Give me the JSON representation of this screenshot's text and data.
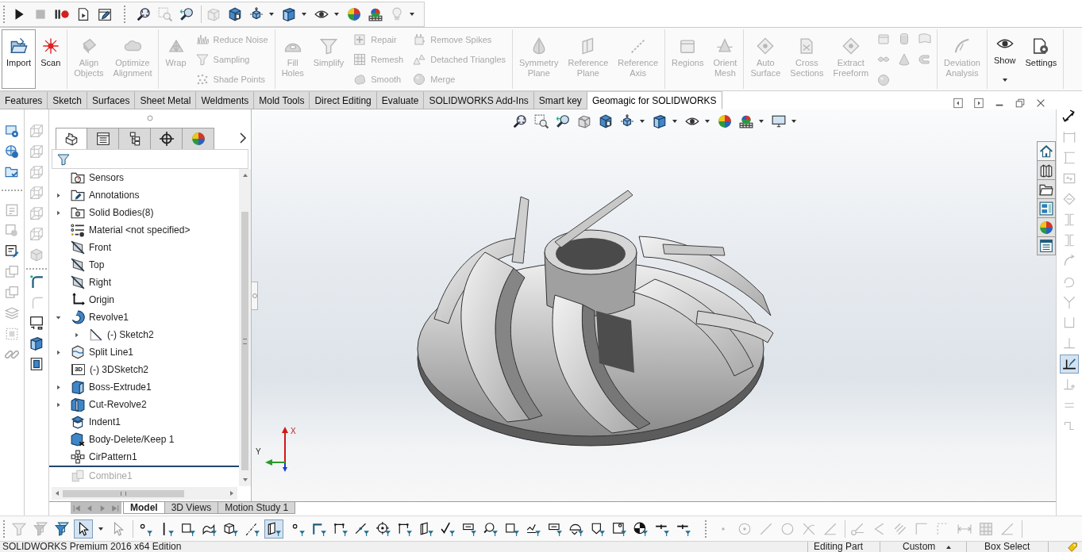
{
  "quick_toolbar": {
    "groups": [
      [
        {
          "disabled": false
        },
        {
          "disabled": true
        },
        {
          "disabled": false
        },
        {
          "disabled": false
        },
        {
          "disabled": false
        }
      ],
      [
        {
          "disabled": false
        },
        {
          "disabled": true
        },
        {
          "disabled": false
        }
      ],
      [
        {
          "disabled": true
        },
        {
          "disabled": false
        },
        {
          "disabled": false,
          "dropdown": true
        },
        {
          "disabled": false,
          "dropdown": true
        },
        {
          "disabled": false,
          "dropdown": true
        },
        {
          "disabled": false
        },
        {
          "disabled": false
        },
        {
          "disabled": true,
          "dropdown": true
        }
      ]
    ]
  },
  "ribbon": {
    "groups": [
      {
        "columns": [
          {
            "kind": "large",
            "label": "Import",
            "disabled": false,
            "highlighted": true
          },
          {
            "kind": "large",
            "label": "Scan",
            "disabled": false,
            "highlighted": false
          }
        ]
      },
      {
        "columns": [
          {
            "kind": "large",
            "label": "Align Objects",
            "disabled": true,
            "highlighted": false
          },
          {
            "kind": "large",
            "label": "Optimize Alignment",
            "disabled": true,
            "highlighted": false
          }
        ]
      },
      {
        "columns": [
          {
            "kind": "large",
            "label": "Wrap",
            "disabled": true,
            "highlighted": false
          },
          {
            "kind": "stack",
            "items": [
              {
                "label": "Reduce Noise",
                "disabled": true
              },
              {
                "label": "Sampling",
                "disabled": true
              },
              {
                "label": "Shade Points",
                "disabled": true
              }
            ]
          }
        ]
      },
      {
        "columns": [
          {
            "kind": "large",
            "label": "Fill Holes",
            "disabled": true,
            "highlighted": false
          },
          {
            "kind": "large",
            "label": "Simplify",
            "disabled": true,
            "highlighted": false
          },
          {
            "kind": "stack",
            "items": [
              {
                "label": "Repair",
                "disabled": true
              },
              {
                "label": "Remesh",
                "disabled": true
              },
              {
                "label": "Smooth",
                "disabled": true
              }
            ]
          },
          {
            "kind": "stack",
            "items": [
              {
                "label": "Remove Spikes",
                "disabled": true
              },
              {
                "label": "Detached Triangles",
                "disabled": true
              },
              {
                "label": "Merge",
                "disabled": true
              }
            ]
          }
        ]
      },
      {
        "columns": [
          {
            "kind": "large",
            "label": "Symmetry Plane",
            "disabled": true,
            "highlighted": false
          },
          {
            "kind": "large",
            "label": "Reference Plane",
            "disabled": true,
            "highlighted": false
          },
          {
            "kind": "large",
            "label": "Reference Axis",
            "disabled": true,
            "highlighted": false
          }
        ]
      },
      {
        "columns": [
          {
            "kind": "large",
            "label": "Regions",
            "disabled": true,
            "highlighted": false
          },
          {
            "kind": "large",
            "label": "Orient Mesh",
            "disabled": true,
            "highlighted": false
          }
        ]
      },
      {
        "columns": [
          {
            "kind": "large",
            "label": "Auto Surface",
            "disabled": true,
            "highlighted": false
          },
          {
            "kind": "large",
            "label": "Cross Sections",
            "disabled": true,
            "highlighted": false
          },
          {
            "kind": "large",
            "label": "Extract Freeform",
            "disabled": true,
            "highlighted": false
          },
          {
            "kind": "grid",
            "items": [
              {
                "disabled": true
              },
              {
                "disabled": true
              },
              {
                "disabled": true
              },
              {
                "disabled": true
              },
              {
                "disabled": true
              },
              {
                "disabled": true
              },
              {
                "disabled": true
              }
            ]
          }
        ]
      },
      {
        "columns": [
          {
            "kind": "large",
            "label": "Deviation Analysis",
            "disabled": true,
            "highlighted": false
          }
        ]
      },
      {
        "columns": [
          {
            "kind": "large",
            "label": "Show",
            "disabled": false,
            "highlighted": false,
            "dropdown": true
          },
          {
            "kind": "large",
            "label": "Settings",
            "disabled": false,
            "highlighted": false
          }
        ]
      }
    ]
  },
  "command_tabs": [
    {
      "label": "Features",
      "selected": false
    },
    {
      "label": "Sketch",
      "selected": false
    },
    {
      "label": "Surfaces",
      "selected": false
    },
    {
      "label": "Sheet Metal",
      "selected": false
    },
    {
      "label": "Weldments",
      "selected": false
    },
    {
      "label": "Mold Tools",
      "selected": false
    },
    {
      "label": "Direct Editing",
      "selected": false
    },
    {
      "label": "Evaluate",
      "selected": false
    },
    {
      "label": "SOLIDWORKS Add-Ins",
      "selected": false
    },
    {
      "label": "Smart key",
      "selected": false
    },
    {
      "label": "Geomagic for SOLIDWORKS",
      "selected": true
    }
  ],
  "left_toolbar": {
    "groups": [
      [
        {
          "disabled": false
        },
        {
          "disabled": false
        },
        {
          "disabled": false
        }
      ],
      [
        {
          "disabled": true
        },
        {
          "disabled": true
        },
        {
          "disabled": false
        },
        {
          "disabled": true
        },
        {
          "disabled": true
        },
        {
          "disabled": true
        },
        {
          "disabled": true
        },
        {
          "disabled": true
        }
      ]
    ]
  },
  "view_toolbar": {
    "groups": [
      [
        {
          "disabled": true
        },
        {
          "disabled": true
        },
        {
          "disabled": true
        },
        {
          "disabled": true
        },
        {
          "disabled": true
        },
        {
          "disabled": true
        },
        {
          "disabled": true
        }
      ],
      [
        {
          "disabled": false
        },
        {
          "disabled": true
        },
        {
          "disabled": false
        },
        {
          "disabled": false
        },
        {
          "disabled": false
        }
      ]
    ]
  },
  "feature_manager": {
    "tabs": [
      {
        "selected": true
      },
      {
        "selected": false
      },
      {
        "selected": false
      },
      {
        "selected": false
      },
      {
        "selected": false
      }
    ],
    "tree": [
      {
        "label": "Sensors",
        "kind": "sensors",
        "rolled_back": false
      },
      {
        "label": "Annotations",
        "kind": "annotations",
        "expanded": false,
        "rolled_back": false
      },
      {
        "label": "Solid Bodies(8)",
        "kind": "bodies",
        "expanded": false,
        "rolled_back": false
      },
      {
        "label": "Material <not specified>",
        "kind": "material",
        "rolled_back": false
      },
      {
        "label": "Front",
        "kind": "plane",
        "rolled_back": false
      },
      {
        "label": "Top",
        "kind": "plane",
        "rolled_back": false
      },
      {
        "label": "Right",
        "kind": "plane",
        "rolled_back": false
      },
      {
        "label": "Origin",
        "kind": "origin",
        "rolled_back": false
      },
      {
        "label": "Revolve1",
        "kind": "revolve",
        "expanded": true,
        "rolled_back": false,
        "children": [
          {
            "label": "(-) Sketch2",
            "kind": "sketch",
            "expanded": false,
            "rolled_back": false
          }
        ]
      },
      {
        "label": "Split Line1",
        "kind": "splitline",
        "expanded": false,
        "rolled_back": false
      },
      {
        "label": "(-) 3DSketch2",
        "kind": "sketch3d",
        "badge": "3D",
        "rolled_back": false
      },
      {
        "label": "Boss-Extrude1",
        "kind": "extrude",
        "expanded": false,
        "rolled_back": false
      },
      {
        "label": "Cut-Revolve2",
        "kind": "cut",
        "expanded": false,
        "rolled_back": false
      },
      {
        "label": "Indent1",
        "kind": "indent",
        "rolled_back": false
      },
      {
        "label": "Body-Delete/Keep 1",
        "kind": "delete",
        "rolled_back": false
      },
      {
        "label": "CirPattern1",
        "kind": "pattern",
        "rolled_back": false
      },
      {
        "label": "Combine1",
        "kind": "combine",
        "rolled_back": true
      }
    ]
  },
  "viewport": {
    "heads_up_toolbar": [
      {
        "kind": "button"
      },
      {
        "kind": "button"
      },
      {
        "kind": "button"
      },
      {
        "kind": "button"
      },
      {
        "kind": "button"
      },
      {
        "kind": "dropdown"
      },
      {
        "kind": "dropdown"
      },
      {
        "kind": "dropdown"
      },
      {
        "kind": "button"
      },
      {
        "kind": "dropdown"
      },
      {
        "kind": "dropdown"
      }
    ],
    "triad": {
      "x_label": "X",
      "y_label": "Y"
    }
  },
  "sketch_toolbar": [
    {
      "disabled": false,
      "selected": false
    },
    {
      "disabled": true,
      "selected": false
    },
    {
      "disabled": true,
      "selected": false
    },
    {
      "disabled": true,
      "selected": false
    },
    {
      "disabled": true,
      "selected": false
    },
    {
      "disabled": true,
      "selected": false
    },
    {
      "disabled": true,
      "selected": false
    },
    {
      "disabled": true,
      "selected": false
    },
    {
      "disabled": true,
      "selected": false
    },
    {
      "disabled": true,
      "selected": false
    },
    {
      "disabled": true,
      "selected": false
    },
    {
      "disabled": true,
      "selected": false
    },
    {
      "disabled": false,
      "selected": true
    },
    {
      "disabled": true,
      "selected": false
    },
    {
      "disabled": true,
      "selected": false
    },
    {
      "disabled": true,
      "selected": false
    }
  ],
  "bottom_tabs": {
    "navigation": [
      {
        "disabled": true
      },
      {
        "disabled": true
      },
      {
        "disabled": true
      },
      {
        "disabled": true
      }
    ],
    "tabs": [
      {
        "label": "Model",
        "selected": true
      },
      {
        "label": "3D Views",
        "selected": false
      },
      {
        "label": "Motion Study 1",
        "selected": false
      }
    ]
  },
  "selection_toolbar": {
    "groups": [
      [
        {
          "disabled": true,
          "selected": false
        },
        {
          "disabled": true,
          "selected": false
        },
        {
          "disabled": false,
          "selected": false
        },
        {
          "disabled": false,
          "selected": true,
          "dropdown": true
        },
        {
          "disabled": true,
          "selected": false
        }
      ],
      [
        {
          "disabled": false,
          "selected": false
        },
        {
          "disabled": false,
          "selected": false
        },
        {
          "disabled": false,
          "selected": false
        },
        {
          "disabled": false,
          "selected": false
        },
        {
          "disabled": false,
          "selected": false
        },
        {
          "disabled": false,
          "selected": false
        },
        {
          "disabled": false,
          "selected": true
        },
        {
          "disabled": false,
          "selected": false
        },
        {
          "disabled": false,
          "selected": false
        },
        {
          "disabled": false,
          "selected": false
        },
        {
          "disabled": false,
          "selected": false
        },
        {
          "disabled": false,
          "selected": false
        },
        {
          "disabled": false,
          "selected": false
        },
        {
          "disabled": false,
          "selected": false
        },
        {
          "disabled": false,
          "selected": false
        },
        {
          "disabled": false,
          "selected": false
        },
        {
          "disabled": false,
          "selected": false
        },
        {
          "disabled": false,
          "selected": false
        },
        {
          "disabled": false,
          "selected": false
        },
        {
          "disabled": false,
          "selected": false
        },
        {
          "disabled": false,
          "selected": false
        },
        {
          "disabled": false,
          "selected": false
        },
        {
          "disabled": false,
          "selected": false
        },
        {
          "disabled": false,
          "selected": false
        },
        {
          "disabled": false,
          "selected": false
        },
        {
          "disabled": false,
          "selected": false
        }
      ],
      [
        {
          "disabled": true,
          "selected": false
        },
        {
          "disabled": true,
          "selected": false
        },
        {
          "disabled": true,
          "selected": false
        },
        {
          "disabled": true,
          "selected": false
        },
        {
          "disabled": true,
          "selected": false
        },
        {
          "disabled": true,
          "selected": false
        }
      ],
      [
        {
          "disabled": true,
          "selected": false
        },
        {
          "disabled": true,
          "selected": false
        },
        {
          "disabled": true,
          "selected": false
        },
        {
          "disabled": true,
          "selected": false
        },
        {
          "disabled": true,
          "selected": false
        },
        {
          "disabled": true,
          "selected": false
        },
        {
          "disabled": true,
          "selected": false
        },
        {
          "disabled": true,
          "selected": false
        }
      ]
    ]
  },
  "status_bar": {
    "product": "SOLIDWORKS Premium 2016 x64 Edition",
    "mode": "Editing Part",
    "units": "Custom",
    "selection_mode": "Box Select"
  }
}
